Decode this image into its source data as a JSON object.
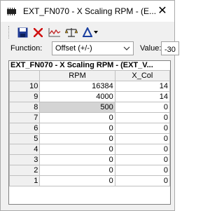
{
  "window": {
    "title": "EXT_FN070 - X Scaling RPM - (E...",
    "close_glyph": "✕"
  },
  "toolbar": {
    "icons": [
      "save-icon",
      "delete-icon",
      "graph-icon",
      "balance-scale-icon",
      "delta-icon"
    ],
    "accent_colors": {
      "save": "#1f3a93",
      "delete": "#d01010",
      "graph": "#c02020",
      "delta": "#1a3fa0"
    }
  },
  "function_row": {
    "function_label": "Function:",
    "function_value": "Offset (+/-)",
    "value_label": "Value:",
    "value_input": "-30"
  },
  "table": {
    "title": "EXT_FN070 - X Scaling RPM - (EXT_V...",
    "columns": [
      "RPM",
      "X_Col"
    ],
    "selected_row_index": 2,
    "rows": [
      {
        "index": "10",
        "rpm": "16384",
        "xcol": "14"
      },
      {
        "index": "9",
        "rpm": "4000",
        "xcol": "14"
      },
      {
        "index": "8",
        "rpm": "500",
        "xcol": "0"
      },
      {
        "index": "7",
        "rpm": "0",
        "xcol": "0"
      },
      {
        "index": "6",
        "rpm": "0",
        "xcol": "0"
      },
      {
        "index": "5",
        "rpm": "0",
        "xcol": "0"
      },
      {
        "index": "4",
        "rpm": "0",
        "xcol": "0"
      },
      {
        "index": "3",
        "rpm": "0",
        "xcol": "0"
      },
      {
        "index": "2",
        "rpm": "0",
        "xcol": "0"
      },
      {
        "index": "1",
        "rpm": "0",
        "xcol": "0"
      }
    ]
  }
}
